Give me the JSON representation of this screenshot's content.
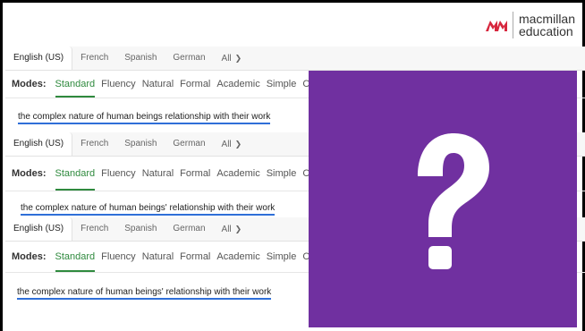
{
  "logo": {
    "line1": "macmillan",
    "line2": "education"
  },
  "panels": [
    {
      "tabs": [
        "English (US)",
        "French",
        "Spanish",
        "German",
        "All"
      ],
      "modes_label": "Modes:",
      "modes": [
        "Standard",
        "Fluency",
        "Natural",
        "Formal",
        "Academic",
        "Simple",
        "C"
      ],
      "sentence": "the complex nature of human beings relationship with their work"
    },
    {
      "tabs": [
        "English (US)",
        "French",
        "Spanish",
        "German",
        "All"
      ],
      "modes_label": "Modes:",
      "modes": [
        "Standard",
        "Fluency",
        "Natural",
        "Formal",
        "Academic",
        "Simple",
        "C"
      ],
      "sentence": "the complex nature of human beings' relationship with their work"
    },
    {
      "tabs": [
        "English (US)",
        "French",
        "Spanish",
        "German",
        "All"
      ],
      "modes_label": "Modes:",
      "modes": [
        "Standard",
        "Fluency",
        "Natural",
        "Formal",
        "Academic",
        "Simple",
        "C"
      ],
      "sentence": "the complex nature of human beings' relationship with their work"
    }
  ],
  "overlay": {
    "symbol": "?",
    "color": "#7030a0"
  },
  "colors": {
    "accent_green": "#2f8a3e",
    "underline_blue": "#2f6fd8",
    "logo_red": "#d7263d"
  }
}
